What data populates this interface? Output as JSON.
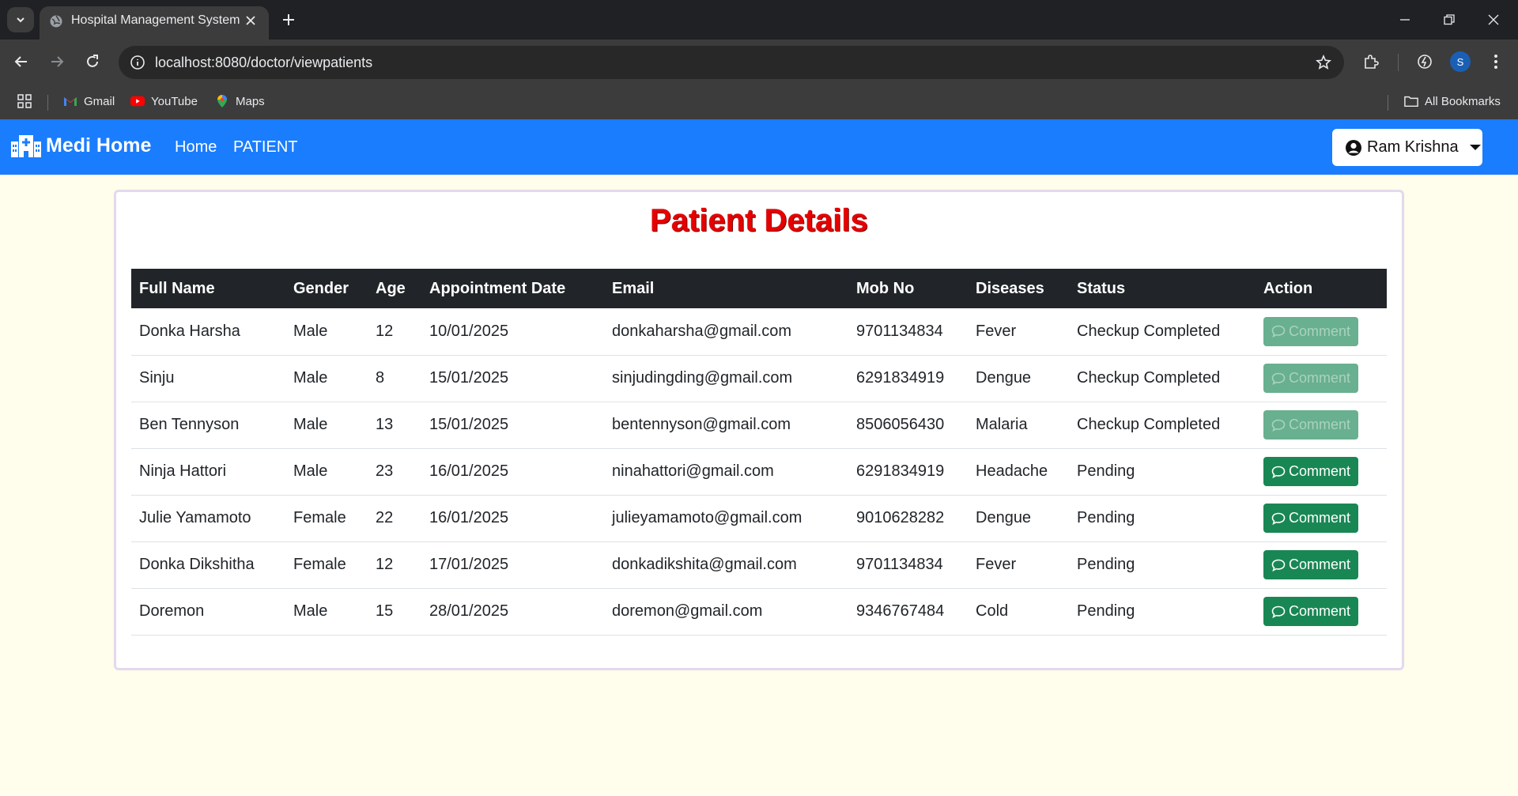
{
  "browser": {
    "tab_title": "Hospital Management System",
    "url": "localhost:8080/doctor/viewpatients",
    "profile_initial": "S",
    "bookmarks": [
      {
        "label": "Gmail",
        "icon": "gmail-icon"
      },
      {
        "label": "YouTube",
        "icon": "youtube-icon"
      },
      {
        "label": "Maps",
        "icon": "maps-icon"
      }
    ],
    "all_bookmarks": "All Bookmarks"
  },
  "app": {
    "brand": "Medi Home",
    "nav": {
      "home": "Home",
      "patient": "PATIENT"
    },
    "user": "Ram Krishna",
    "brand_color": "#1a7dfe"
  },
  "page": {
    "title": "Patient Details",
    "columns": [
      "Full Name",
      "Gender",
      "Age",
      "Appointment Date",
      "Email",
      "Mob No",
      "Diseases",
      "Status",
      "Action"
    ],
    "rows": [
      {
        "name": "Donka Harsha",
        "gender": "Male",
        "age": "12",
        "date": "10/01/2025",
        "email": "donkaharsha@gmail.com",
        "mobile": "9701134834",
        "disease": "Fever",
        "status": "Checkup Completed",
        "action": "Comment",
        "action_enabled": false
      },
      {
        "name": "Sinju",
        "gender": "Male",
        "age": "8",
        "date": "15/01/2025",
        "email": "sinjudingding@gmail.com",
        "mobile": "6291834919",
        "disease": "Dengue",
        "status": "Checkup Completed",
        "action": "Comment",
        "action_enabled": false
      },
      {
        "name": "Ben Tennyson",
        "gender": "Male",
        "age": "13",
        "date": "15/01/2025",
        "email": "bentennyson@gmail.com",
        "mobile": "8506056430",
        "disease": "Malaria",
        "status": "Checkup Completed",
        "action": "Comment",
        "action_enabled": false
      },
      {
        "name": "Ninja Hattori",
        "gender": "Male",
        "age": "23",
        "date": "16/01/2025",
        "email": "ninahattori@gmail.com",
        "mobile": "6291834919",
        "disease": "Headache",
        "status": "Pending",
        "action": "Comment",
        "action_enabled": true
      },
      {
        "name": "Julie Yamamoto",
        "gender": "Female",
        "age": "22",
        "date": "16/01/2025",
        "email": "julieyamamoto@gmail.com",
        "mobile": "9010628282",
        "disease": "Dengue",
        "status": "Pending",
        "action": "Comment",
        "action_enabled": true
      },
      {
        "name": "Donka Dikshitha",
        "gender": "Female",
        "age": "12",
        "date": "17/01/2025",
        "email": "donkadikshita@gmail.com",
        "mobile": "9701134834",
        "disease": "Fever",
        "status": "Pending",
        "action": "Comment",
        "action_enabled": true
      },
      {
        "name": "Doremon",
        "gender": "Male",
        "age": "15",
        "date": "28/01/2025",
        "email": "doremon@gmail.com",
        "mobile": "9346767484",
        "disease": "Cold",
        "status": "Pending",
        "action": "Comment",
        "action_enabled": true
      }
    ]
  }
}
